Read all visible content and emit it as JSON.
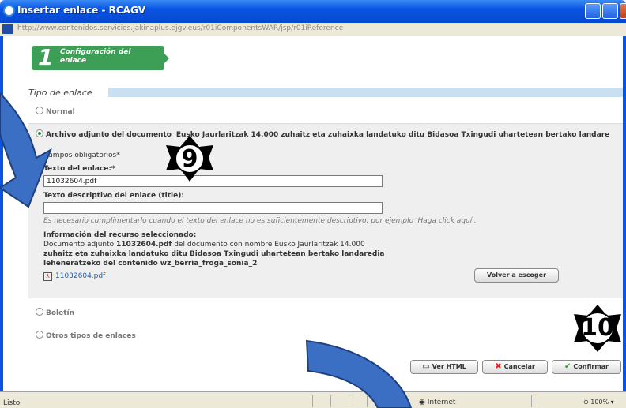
{
  "window": {
    "title": "Insertar enlace - RCAGV"
  },
  "address": {
    "url": "http://www.contenidos.servicios.jakinaplus.ejgv.eus/r01iComponentsWAR/jsp/r01iReference"
  },
  "step": {
    "number": "1",
    "label": "Configuración del enlace"
  },
  "tipo": {
    "label": "Tipo de enlace"
  },
  "options": {
    "normal": "Normal",
    "archivo": "Archivo adjunto del documento 'Eusko Jaurlaritzak 14.000 zuhaitz eta zuhaixka landatuko ditu Bidasoa Txingudi uhartetean bertako landare",
    "boletin": "Boletín",
    "otros": "Otros tipos de enlaces"
  },
  "form": {
    "required_note": "Campos obligatorios*",
    "texto_label": "Texto del enlace:*",
    "texto_value": "11032604.pdf",
    "desc_label": "Texto descriptivo del enlace (title):",
    "desc_value": "",
    "hint": "Es necesario cumplimentarlo cuando el texto del enlace no es suficientemente descriptivo, por ejemplo 'Haga click aquí'.",
    "info_title": "Información del recurso seleccionado:",
    "info_line1_pre": "Documento adjunto ",
    "info_line1_file": "11032604.pdf",
    "info_line1_post": " del documento con nombre Eusko Jaurlaritzak 14.000",
    "info_line2": "zuhaitz eta zuhaixka landatuko ditu Bidasoa Txingudi uhartetean bertako landaredia",
    "info_line3": "leheneratzeko del contenido wz_berria_froga_sonia_2",
    "pdf_link": "11032604.pdf",
    "volver_label": "Volver a escoger"
  },
  "buttons": {
    "ver_html": "Ver HTML",
    "cancelar": "Cancelar",
    "confirmar": "Confirmar"
  },
  "callouts": {
    "nine": "9",
    "ten": "10"
  },
  "status": {
    "text": "Listo",
    "zone": "Internet",
    "zoom": "100%"
  }
}
